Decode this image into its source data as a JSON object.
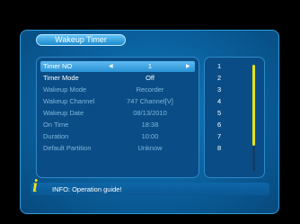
{
  "title": "Wakeup Timer",
  "menu": {
    "rows": [
      {
        "label": "Timer NO",
        "value": "1",
        "state": "selected"
      },
      {
        "label": "Timer Mode",
        "value": "Off",
        "state": "normal"
      },
      {
        "label": "Wakeup Mode",
        "value": "Recorder",
        "state": "disabled"
      },
      {
        "label": "Wakeup Channel",
        "value": "747 Channel[V]",
        "state": "disabled"
      },
      {
        "label": "Wakeup Date",
        "value": "08/13/2010",
        "state": "disabled"
      },
      {
        "label": "On Time",
        "value": "18:38",
        "state": "disabled"
      },
      {
        "label": "Duration",
        "value": "10:00",
        "state": "disabled"
      },
      {
        "label": "Default Partition",
        "value": "Unknow",
        "state": "disabled"
      }
    ],
    "arrow_left": "◀",
    "arrow_right": "▶"
  },
  "timer_list": [
    "1",
    "2",
    "3",
    "4",
    "5",
    "6",
    "7",
    "8"
  ],
  "scroll_position": 0.0,
  "info": {
    "icon": "i",
    "icon_name": "info-icon",
    "text": "INFO: Operation guide!"
  },
  "colors": {
    "panel_blue": "#0a5f9c",
    "highlight": "#3aa3e4",
    "scroll_thumb": "#e8e21a",
    "info_icon": "#f2e21b"
  }
}
